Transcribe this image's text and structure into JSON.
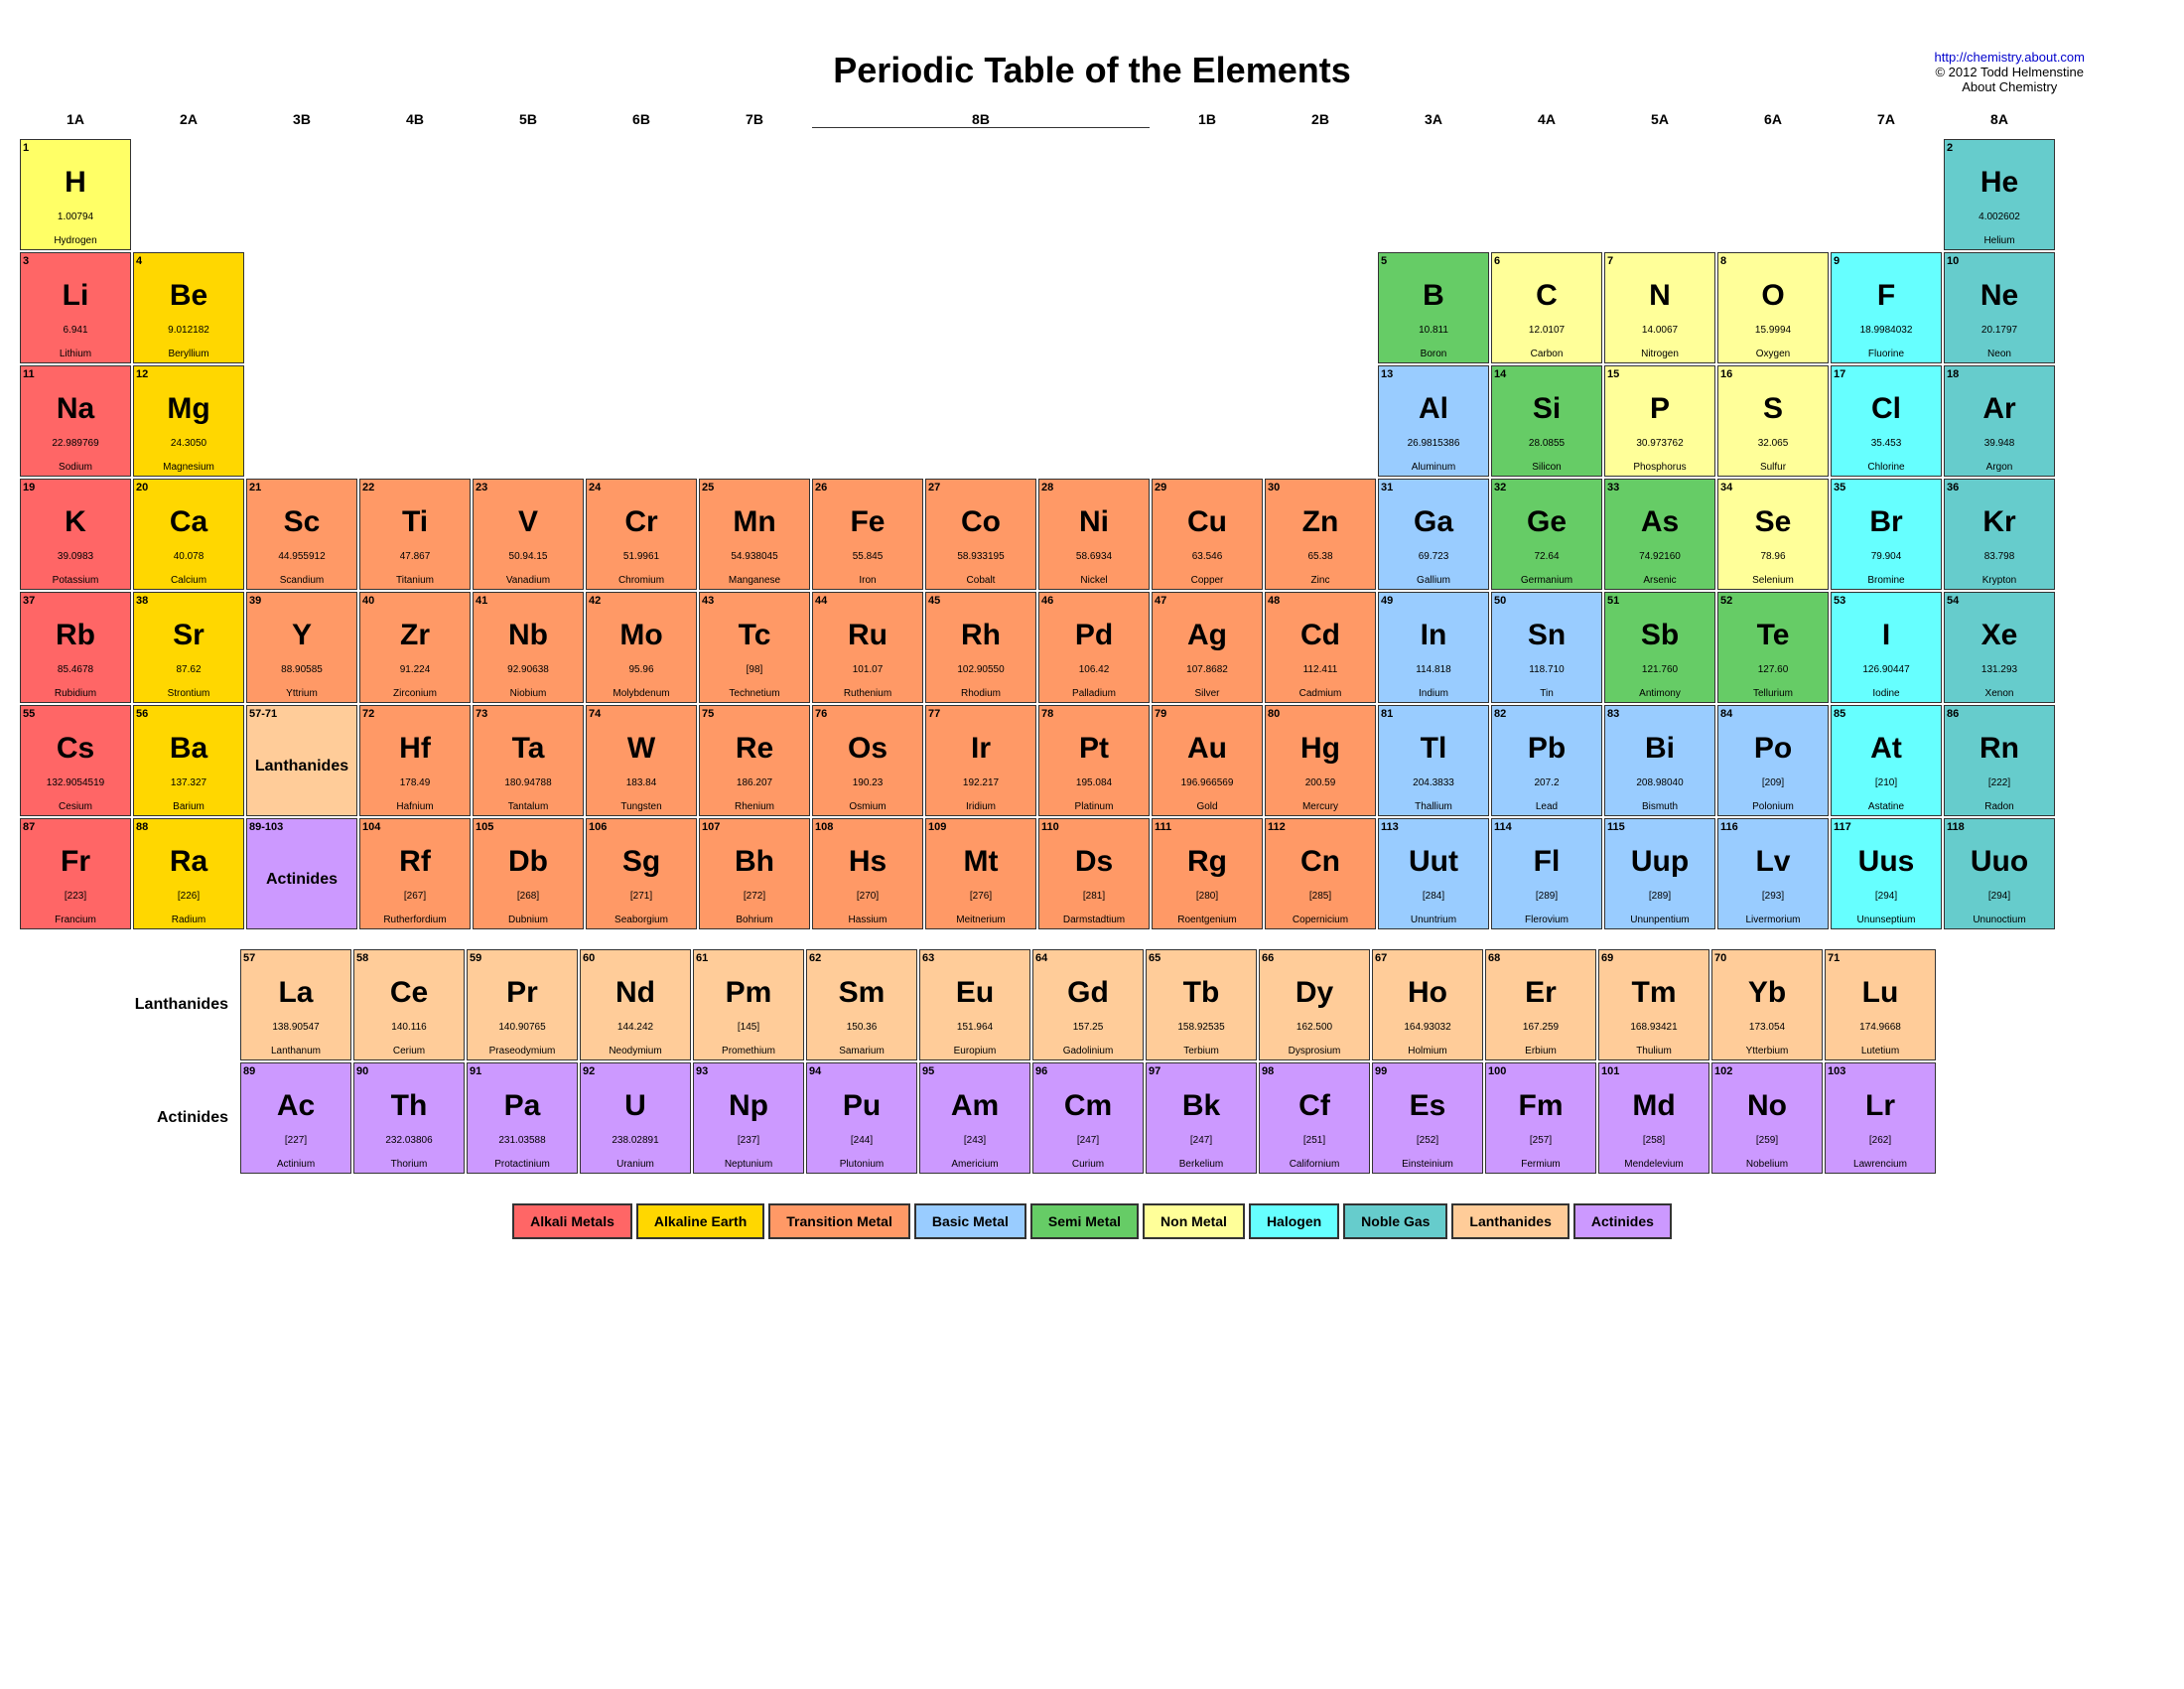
{
  "title": "Periodic Table of the Elements",
  "credit": {
    "url": "http://chemistry.about.com",
    "line1": "http://chemistry.about.com",
    "line2": "© 2012 Todd Helmenstine",
    "line3": "About Chemistry"
  },
  "groups": [
    "1A",
    "2A",
    "3B",
    "4B",
    "5B",
    "6B",
    "7B",
    "",
    "8B",
    "",
    "1B",
    "2B",
    "3A",
    "4A",
    "5A",
    "6A",
    "7A",
    "8A"
  ],
  "elements": [
    {
      "num": "1",
      "sym": "H",
      "mass": "1.00794",
      "name": "Hydrogen",
      "cat": "hydrogen-color",
      "col": 1,
      "row": 1
    },
    {
      "num": "2",
      "sym": "He",
      "mass": "4.002602",
      "name": "Helium",
      "cat": "noble",
      "col": 18,
      "row": 1
    },
    {
      "num": "3",
      "sym": "Li",
      "mass": "6.941",
      "name": "Lithium",
      "cat": "alkali",
      "col": 1,
      "row": 2
    },
    {
      "num": "4",
      "sym": "Be",
      "mass": "9.012182",
      "name": "Beryllium",
      "cat": "alkaline",
      "col": 2,
      "row": 2
    },
    {
      "num": "5",
      "sym": "B",
      "mass": "10.811",
      "name": "Boron",
      "cat": "semi-metal",
      "col": 13,
      "row": 2
    },
    {
      "num": "6",
      "sym": "C",
      "mass": "12.0107",
      "name": "Carbon",
      "cat": "non-metal",
      "col": 14,
      "row": 2
    },
    {
      "num": "7",
      "sym": "N",
      "mass": "14.0067",
      "name": "Nitrogen",
      "cat": "non-metal",
      "col": 15,
      "row": 2
    },
    {
      "num": "8",
      "sym": "O",
      "mass": "15.9994",
      "name": "Oxygen",
      "cat": "non-metal",
      "col": 16,
      "row": 2
    },
    {
      "num": "9",
      "sym": "F",
      "mass": "18.9984032",
      "name": "Fluorine",
      "cat": "halogen",
      "col": 17,
      "row": 2
    },
    {
      "num": "10",
      "sym": "Ne",
      "mass": "20.1797",
      "name": "Neon",
      "cat": "noble",
      "col": 18,
      "row": 2
    },
    {
      "num": "11",
      "sym": "Na",
      "mass": "22.989769",
      "name": "Sodium",
      "cat": "alkali",
      "col": 1,
      "row": 3
    },
    {
      "num": "12",
      "sym": "Mg",
      "mass": "24.3050",
      "name": "Magnesium",
      "cat": "alkaline",
      "col": 2,
      "row": 3
    },
    {
      "num": "13",
      "sym": "Al",
      "mass": "26.9815386",
      "name": "Aluminum",
      "cat": "basic-metal",
      "col": 13,
      "row": 3
    },
    {
      "num": "14",
      "sym": "Si",
      "mass": "28.0855",
      "name": "Silicon",
      "cat": "semi-metal",
      "col": 14,
      "row": 3
    },
    {
      "num": "15",
      "sym": "P",
      "mass": "30.973762",
      "name": "Phosphorus",
      "cat": "non-metal",
      "col": 15,
      "row": 3
    },
    {
      "num": "16",
      "sym": "S",
      "mass": "32.065",
      "name": "Sulfur",
      "cat": "non-metal",
      "col": 16,
      "row": 3
    },
    {
      "num": "17",
      "sym": "Cl",
      "mass": "35.453",
      "name": "Chlorine",
      "cat": "halogen",
      "col": 17,
      "row": 3
    },
    {
      "num": "18",
      "sym": "Ar",
      "mass": "39.948",
      "name": "Argon",
      "cat": "noble",
      "col": 18,
      "row": 3
    },
    {
      "num": "19",
      "sym": "K",
      "mass": "39.0983",
      "name": "Potassium",
      "cat": "alkali",
      "col": 1,
      "row": 4
    },
    {
      "num": "20",
      "sym": "Ca",
      "mass": "40.078",
      "name": "Calcium",
      "cat": "alkaline",
      "col": 2,
      "row": 4
    },
    {
      "num": "21",
      "sym": "Sc",
      "mass": "44.955912",
      "name": "Scandium",
      "cat": "transition",
      "col": 3,
      "row": 4
    },
    {
      "num": "22",
      "sym": "Ti",
      "mass": "47.867",
      "name": "Titanium",
      "cat": "transition",
      "col": 4,
      "row": 4
    },
    {
      "num": "23",
      "sym": "V",
      "mass": "50.94.15",
      "name": "Vanadium",
      "cat": "transition",
      "col": 5,
      "row": 4
    },
    {
      "num": "24",
      "sym": "Cr",
      "mass": "51.9961",
      "name": "Chromium",
      "cat": "transition",
      "col": 6,
      "row": 4
    },
    {
      "num": "25",
      "sym": "Mn",
      "mass": "54.938045",
      "name": "Manganese",
      "cat": "transition",
      "col": 7,
      "row": 4
    },
    {
      "num": "26",
      "sym": "Fe",
      "mass": "55.845",
      "name": "Iron",
      "cat": "transition",
      "col": 8,
      "row": 4
    },
    {
      "num": "27",
      "sym": "Co",
      "mass": "58.933195",
      "name": "Cobalt",
      "cat": "transition",
      "col": 9,
      "row": 4
    },
    {
      "num": "28",
      "sym": "Ni",
      "mass": "58.6934",
      "name": "Nickel",
      "cat": "transition",
      "col": 10,
      "row": 4
    },
    {
      "num": "29",
      "sym": "Cu",
      "mass": "63.546",
      "name": "Copper",
      "cat": "transition",
      "col": 11,
      "row": 4
    },
    {
      "num": "30",
      "sym": "Zn",
      "mass": "65.38",
      "name": "Zinc",
      "cat": "transition",
      "col": 12,
      "row": 4
    },
    {
      "num": "31",
      "sym": "Ga",
      "mass": "69.723",
      "name": "Gallium",
      "cat": "basic-metal",
      "col": 13,
      "row": 4
    },
    {
      "num": "32",
      "sym": "Ge",
      "mass": "72.64",
      "name": "Germanium",
      "cat": "semi-metal",
      "col": 14,
      "row": 4
    },
    {
      "num": "33",
      "sym": "As",
      "mass": "74.92160",
      "name": "Arsenic",
      "cat": "semi-metal",
      "col": 15,
      "row": 4
    },
    {
      "num": "34",
      "sym": "Se",
      "mass": "78.96",
      "name": "Selenium",
      "cat": "non-metal",
      "col": 16,
      "row": 4
    },
    {
      "num": "35",
      "sym": "Br",
      "mass": "79.904",
      "name": "Bromine",
      "cat": "halogen",
      "col": 17,
      "row": 4
    },
    {
      "num": "36",
      "sym": "Kr",
      "mass": "83.798",
      "name": "Krypton",
      "cat": "noble",
      "col": 18,
      "row": 4
    },
    {
      "num": "37",
      "sym": "Rb",
      "mass": "85.4678",
      "name": "Rubidium",
      "cat": "alkali",
      "col": 1,
      "row": 5
    },
    {
      "num": "38",
      "sym": "Sr",
      "mass": "87.62",
      "name": "Strontium",
      "cat": "alkaline",
      "col": 2,
      "row": 5
    },
    {
      "num": "39",
      "sym": "Y",
      "mass": "88.90585",
      "name": "Yttrium",
      "cat": "transition",
      "col": 3,
      "row": 5
    },
    {
      "num": "40",
      "sym": "Zr",
      "mass": "91.224",
      "name": "Zirconium",
      "cat": "transition",
      "col": 4,
      "row": 5
    },
    {
      "num": "41",
      "sym": "Nb",
      "mass": "92.90638",
      "name": "Niobium",
      "cat": "transition",
      "col": 5,
      "row": 5
    },
    {
      "num": "42",
      "sym": "Mo",
      "mass": "95.96",
      "name": "Molybdenum",
      "cat": "transition",
      "col": 6,
      "row": 5
    },
    {
      "num": "43",
      "sym": "Tc",
      "mass": "[98]",
      "name": "Technetium",
      "cat": "transition",
      "col": 7,
      "row": 5
    },
    {
      "num": "44",
      "sym": "Ru",
      "mass": "101.07",
      "name": "Ruthenium",
      "cat": "transition",
      "col": 8,
      "row": 5
    },
    {
      "num": "45",
      "sym": "Rh",
      "mass": "102.90550",
      "name": "Rhodium",
      "cat": "transition",
      "col": 9,
      "row": 5
    },
    {
      "num": "46",
      "sym": "Pd",
      "mass": "106.42",
      "name": "Palladium",
      "cat": "transition",
      "col": 10,
      "row": 5
    },
    {
      "num": "47",
      "sym": "Ag",
      "mass": "107.8682",
      "name": "Silver",
      "cat": "transition",
      "col": 11,
      "row": 5
    },
    {
      "num": "48",
      "sym": "Cd",
      "mass": "112.411",
      "name": "Cadmium",
      "cat": "transition",
      "col": 12,
      "row": 5
    },
    {
      "num": "49",
      "sym": "In",
      "mass": "114.818",
      "name": "Indium",
      "cat": "basic-metal",
      "col": 13,
      "row": 5
    },
    {
      "num": "50",
      "sym": "Sn",
      "mass": "118.710",
      "name": "Tin",
      "cat": "basic-metal",
      "col": 14,
      "row": 5
    },
    {
      "num": "51",
      "sym": "Sb",
      "mass": "121.760",
      "name": "Antimony",
      "cat": "semi-metal",
      "col": 15,
      "row": 5
    },
    {
      "num": "52",
      "sym": "Te",
      "mass": "127.60",
      "name": "Tellurium",
      "cat": "semi-metal",
      "col": 16,
      "row": 5
    },
    {
      "num": "53",
      "sym": "I",
      "mass": "126.90447",
      "name": "Iodine",
      "cat": "halogen",
      "col": 17,
      "row": 5
    },
    {
      "num": "54",
      "sym": "Xe",
      "mass": "131.293",
      "name": "Xenon",
      "cat": "noble",
      "col": 18,
      "row": 5
    },
    {
      "num": "55",
      "sym": "Cs",
      "mass": "132.9054519",
      "name": "Cesium",
      "cat": "alkali",
      "col": 1,
      "row": 6
    },
    {
      "num": "56",
      "sym": "Ba",
      "mass": "137.327",
      "name": "Barium",
      "cat": "alkaline",
      "col": 2,
      "row": 6
    },
    {
      "num": "57-71",
      "sym": "*",
      "mass": "Lanthanides",
      "name": "",
      "cat": "lanthanide",
      "col": 3,
      "row": 6
    },
    {
      "num": "72",
      "sym": "Hf",
      "mass": "178.49",
      "name": "Hafnium",
      "cat": "transition",
      "col": 4,
      "row": 6
    },
    {
      "num": "73",
      "sym": "Ta",
      "mass": "180.94788",
      "name": "Tantalum",
      "cat": "transition",
      "col": 5,
      "row": 6
    },
    {
      "num": "74",
      "sym": "W",
      "mass": "183.84",
      "name": "Tungsten",
      "cat": "transition",
      "col": 6,
      "row": 6
    },
    {
      "num": "75",
      "sym": "Re",
      "mass": "186.207",
      "name": "Rhenium",
      "cat": "transition",
      "col": 7,
      "row": 6
    },
    {
      "num": "76",
      "sym": "Os",
      "mass": "190.23",
      "name": "Osmium",
      "cat": "transition",
      "col": 8,
      "row": 6
    },
    {
      "num": "77",
      "sym": "Ir",
      "mass": "192.217",
      "name": "Iridium",
      "cat": "transition",
      "col": 9,
      "row": 6
    },
    {
      "num": "78",
      "sym": "Pt",
      "mass": "195.084",
      "name": "Platinum",
      "cat": "transition",
      "col": 10,
      "row": 6
    },
    {
      "num": "79",
      "sym": "Au",
      "mass": "196.966569",
      "name": "Gold",
      "cat": "transition",
      "col": 11,
      "row": 6
    },
    {
      "num": "80",
      "sym": "Hg",
      "mass": "200.59",
      "name": "Mercury",
      "cat": "transition",
      "col": 12,
      "row": 6
    },
    {
      "num": "81",
      "sym": "Tl",
      "mass": "204.3833",
      "name": "Thallium",
      "cat": "basic-metal",
      "col": 13,
      "row": 6
    },
    {
      "num": "82",
      "sym": "Pb",
      "mass": "207.2",
      "name": "Lead",
      "cat": "basic-metal",
      "col": 14,
      "row": 6
    },
    {
      "num": "83",
      "sym": "Bi",
      "mass": "208.98040",
      "name": "Bismuth",
      "cat": "basic-metal",
      "col": 15,
      "row": 6
    },
    {
      "num": "84",
      "sym": "Po",
      "mass": "[209]",
      "name": "Polonium",
      "cat": "basic-metal",
      "col": 16,
      "row": 6
    },
    {
      "num": "85",
      "sym": "At",
      "mass": "[210]",
      "name": "Astatine",
      "cat": "halogen",
      "col": 17,
      "row": 6
    },
    {
      "num": "86",
      "sym": "Rn",
      "mass": "[222]",
      "name": "Radon",
      "cat": "noble",
      "col": 18,
      "row": 6
    },
    {
      "num": "87",
      "sym": "Fr",
      "mass": "[223]",
      "name": "Francium",
      "cat": "alkali",
      "col": 1,
      "row": 7
    },
    {
      "num": "88",
      "sym": "Ra",
      "mass": "[226]",
      "name": "Radium",
      "cat": "alkaline",
      "col": 2,
      "row": 7
    },
    {
      "num": "89-103",
      "sym": "**",
      "mass": "Actinides",
      "name": "",
      "cat": "actinide",
      "col": 3,
      "row": 7
    },
    {
      "num": "104",
      "sym": "Rf",
      "mass": "[267]",
      "name": "Rutherfordium",
      "cat": "transition",
      "col": 4,
      "row": 7
    },
    {
      "num": "105",
      "sym": "Db",
      "mass": "[268]",
      "name": "Dubnium",
      "cat": "transition",
      "col": 5,
      "row": 7
    },
    {
      "num": "106",
      "sym": "Sg",
      "mass": "[271]",
      "name": "Seaborgium",
      "cat": "transition",
      "col": 6,
      "row": 7
    },
    {
      "num": "107",
      "sym": "Bh",
      "mass": "[272]",
      "name": "Bohrium",
      "cat": "transition",
      "col": 7,
      "row": 7
    },
    {
      "num": "108",
      "sym": "Hs",
      "mass": "[270]",
      "name": "Hassium",
      "cat": "transition",
      "col": 8,
      "row": 7
    },
    {
      "num": "109",
      "sym": "Mt",
      "mass": "[276]",
      "name": "Meitnerium",
      "cat": "transition",
      "col": 9,
      "row": 7
    },
    {
      "num": "110",
      "sym": "Ds",
      "mass": "[281]",
      "name": "Darmstadtium",
      "cat": "transition",
      "col": 10,
      "row": 7
    },
    {
      "num": "111",
      "sym": "Rg",
      "mass": "[280]",
      "name": "Roentgenium",
      "cat": "transition",
      "col": 11,
      "row": 7
    },
    {
      "num": "112",
      "sym": "Cn",
      "mass": "[285]",
      "name": "Copernicium",
      "cat": "transition",
      "col": 12,
      "row": 7
    },
    {
      "num": "113",
      "sym": "Uut",
      "mass": "[284]",
      "name": "Ununtrium",
      "cat": "basic-metal",
      "col": 13,
      "row": 7
    },
    {
      "num": "114",
      "sym": "Fl",
      "mass": "[289]",
      "name": "Flerovium",
      "cat": "basic-metal",
      "col": 14,
      "row": 7
    },
    {
      "num": "115",
      "sym": "Uup",
      "mass": "[289]",
      "name": "Ununpentium",
      "cat": "basic-metal",
      "col": 15,
      "row": 7
    },
    {
      "num": "116",
      "sym": "Lv",
      "mass": "[293]",
      "name": "Livermorium",
      "cat": "basic-metal",
      "col": 16,
      "row": 7
    },
    {
      "num": "117",
      "sym": "Uus",
      "mass": "[294]",
      "name": "Ununseptium",
      "cat": "halogen",
      "col": 17,
      "row": 7
    },
    {
      "num": "118",
      "sym": "Uuo",
      "mass": "[294]",
      "name": "Ununoctium",
      "cat": "noble",
      "col": 18,
      "row": 7
    }
  ],
  "lanthanides": [
    {
      "num": "57",
      "sym": "La",
      "mass": "138.90547",
      "name": "Lanthanum",
      "cat": "lanthanide"
    },
    {
      "num": "58",
      "sym": "Ce",
      "mass": "140.116",
      "name": "Cerium",
      "cat": "lanthanide"
    },
    {
      "num": "59",
      "sym": "Pr",
      "mass": "140.90765",
      "name": "Praseodymium",
      "cat": "lanthanide"
    },
    {
      "num": "60",
      "sym": "Nd",
      "mass": "144.242",
      "name": "Neodymium",
      "cat": "lanthanide"
    },
    {
      "num": "61",
      "sym": "Pm",
      "mass": "[145]",
      "name": "Promethium",
      "cat": "lanthanide"
    },
    {
      "num": "62",
      "sym": "Sm",
      "mass": "150.36",
      "name": "Samarium",
      "cat": "lanthanide"
    },
    {
      "num": "63",
      "sym": "Eu",
      "mass": "151.964",
      "name": "Europium",
      "cat": "lanthanide"
    },
    {
      "num": "64",
      "sym": "Gd",
      "mass": "157.25",
      "name": "Gadolinium",
      "cat": "lanthanide"
    },
    {
      "num": "65",
      "sym": "Tb",
      "mass": "158.92535",
      "name": "Terbium",
      "cat": "lanthanide"
    },
    {
      "num": "66",
      "sym": "Dy",
      "mass": "162.500",
      "name": "Dysprosium",
      "cat": "lanthanide"
    },
    {
      "num": "67",
      "sym": "Ho",
      "mass": "164.93032",
      "name": "Holmium",
      "cat": "lanthanide"
    },
    {
      "num": "68",
      "sym": "Er",
      "mass": "167.259",
      "name": "Erbium",
      "cat": "lanthanide"
    },
    {
      "num": "69",
      "sym": "Tm",
      "mass": "168.93421",
      "name": "Thulium",
      "cat": "lanthanide"
    },
    {
      "num": "70",
      "sym": "Yb",
      "mass": "173.054",
      "name": "Ytterbium",
      "cat": "lanthanide"
    },
    {
      "num": "71",
      "sym": "Lu",
      "mass": "174.9668",
      "name": "Lutetium",
      "cat": "lanthanide"
    }
  ],
  "actinides": [
    {
      "num": "89",
      "sym": "Ac",
      "mass": "[227]",
      "name": "Actinium",
      "cat": "actinide"
    },
    {
      "num": "90",
      "sym": "Th",
      "mass": "232.03806",
      "name": "Thorium",
      "cat": "actinide"
    },
    {
      "num": "91",
      "sym": "Pa",
      "mass": "231.03588",
      "name": "Protactinium",
      "cat": "actinide"
    },
    {
      "num": "92",
      "sym": "U",
      "mass": "238.02891",
      "name": "Uranium",
      "cat": "actinide"
    },
    {
      "num": "93",
      "sym": "Np",
      "mass": "[237]",
      "name": "Neptunium",
      "cat": "actinide"
    },
    {
      "num": "94",
      "sym": "Pu",
      "mass": "[244]",
      "name": "Plutonium",
      "cat": "actinide"
    },
    {
      "num": "95",
      "sym": "Am",
      "mass": "[243]",
      "name": "Americium",
      "cat": "actinide"
    },
    {
      "num": "96",
      "sym": "Cm",
      "mass": "[247]",
      "name": "Curium",
      "cat": "actinide"
    },
    {
      "num": "97",
      "sym": "Bk",
      "mass": "[247]",
      "name": "Berkelium",
      "cat": "actinide"
    },
    {
      "num": "98",
      "sym": "Cf",
      "mass": "[251]",
      "name": "Californium",
      "cat": "actinide"
    },
    {
      "num": "99",
      "sym": "Es",
      "mass": "[252]",
      "name": "Einsteinium",
      "cat": "actinide"
    },
    {
      "num": "100",
      "sym": "Fm",
      "mass": "[257]",
      "name": "Fermium",
      "cat": "actinide"
    },
    {
      "num": "101",
      "sym": "Md",
      "mass": "[258]",
      "name": "Mendelevium",
      "cat": "actinide"
    },
    {
      "num": "102",
      "sym": "No",
      "mass": "[259]",
      "name": "Nobelium",
      "cat": "actinide"
    },
    {
      "num": "103",
      "sym": "Lr",
      "mass": "[262]",
      "name": "Lawrencium",
      "cat": "actinide"
    }
  ],
  "legend": [
    {
      "label": "Alkali Metals",
      "cat": "alkali"
    },
    {
      "label": "Alkaline Earth",
      "cat": "alkaline"
    },
    {
      "label": "Transition Metal",
      "cat": "transition"
    },
    {
      "label": "Basic Metal",
      "cat": "basic-metal"
    },
    {
      "label": "Semi Metal",
      "cat": "semi-metal"
    },
    {
      "label": "Non Metal",
      "cat": "non-metal"
    },
    {
      "label": "Halogen",
      "cat": "halogen"
    },
    {
      "label": "Noble Gas",
      "cat": "noble"
    },
    {
      "label": "Lanthanides",
      "cat": "lanthanide"
    },
    {
      "label": "Actinides",
      "cat": "actinide"
    }
  ]
}
